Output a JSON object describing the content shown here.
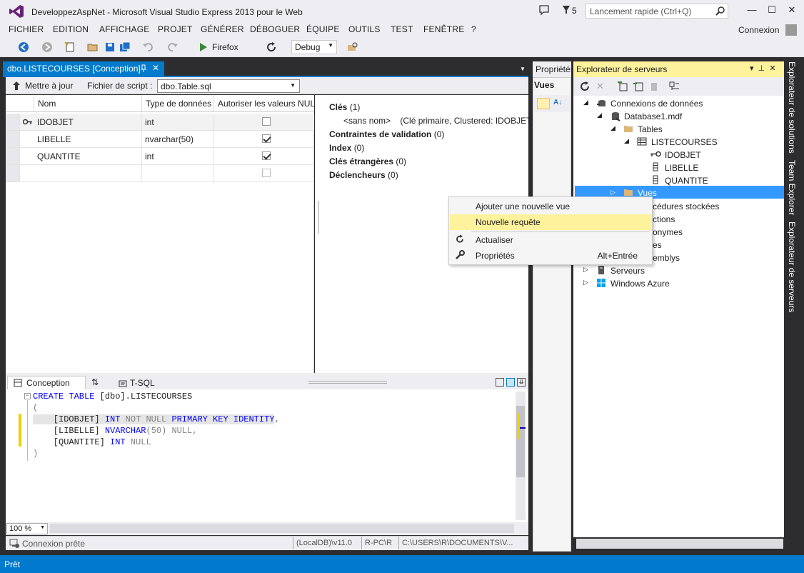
{
  "window": {
    "title": "DeveloppezAspNet - Microsoft Visual Studio Express 2013 pour le Web",
    "notification_count": "5",
    "quick_launch_placeholder": "Lancement rapide (Ctrl+Q)",
    "connexion": "Connexion"
  },
  "menu": [
    "FICHIER",
    "EDITION",
    "AFFICHAGE",
    "PROJET",
    "GÉNÉRER",
    "DÉBOGUER",
    "ÉQUIPE",
    "OUTILS",
    "TEST",
    "FENÊTRE",
    "?"
  ],
  "toolbar": {
    "browser": "Firefox",
    "configuration": "Debug"
  },
  "document": {
    "tab_title": "dbo.LISTECOURSES [Conception]",
    "update_label": "Mettre à jour",
    "script_label": "Fichier de script :",
    "script_file": "dbo.Table.sql"
  },
  "grid": {
    "headers": [
      "Nom",
      "Type de données",
      "Autoriser les valeurs NULL"
    ],
    "rows": [
      {
        "name": "IDOBJET",
        "type": "int",
        "nullable": false,
        "key": true
      },
      {
        "name": "LIBELLE",
        "type": "nvarchar(50)",
        "nullable": true,
        "key": false
      },
      {
        "name": "QUANTITE",
        "type": "int",
        "nullable": true,
        "key": false
      },
      {
        "name": "",
        "type": "",
        "nullable": false,
        "key": false
      }
    ]
  },
  "properties": {
    "keys_label": "Clés",
    "keys_count": "(1)",
    "key_item": "<sans nom>",
    "key_desc": "(Clé primaire, Clustered: IDOBJET)",
    "constraints_label": "Contraintes de validation",
    "constraints_count": "(0)",
    "index_label": "Index",
    "index_count": "(0)",
    "foreign_label": "Clés étrangères",
    "foreign_count": "(0)",
    "triggers_label": "Déclencheurs",
    "triggers_count": "(0)"
  },
  "bottom_tabs": {
    "conception": "Conception",
    "swap": "⇅",
    "tsql": "T-SQL"
  },
  "sql": {
    "l1_kw": "CREATE TABLE",
    "l1_rest": " [dbo].LISTECOURSES",
    "l2": "(",
    "l3_col": "    [IDOBJET]",
    "l3_type": " INT",
    "l3_null": " NOT NULL",
    "l3_pk": " PRIMARY KEY IDENTITY",
    "l3_end": ",",
    "l4_col": "    [LIBELLE]",
    "l4_type": " NVARCHAR",
    "l4_len": "(50)",
    "l4_null": " NULL",
    "l4_end": ",",
    "l5_col": "    [QUANTITE]",
    "l5_type": " INT",
    "l5_null": " NULL",
    "l6": ")"
  },
  "editor_status": {
    "zoom": "100 %",
    "connection": "Connexion prête",
    "server": "(LocalDB)\\v11.0",
    "machine": "R-PC\\R",
    "path": "C:\\USERS\\R\\DOCUMENTS\\V..."
  },
  "properties_panel": {
    "title": "Propriétés",
    "vues": "Vues"
  },
  "server_explorer": {
    "title": "Explorateur de serveurs",
    "tree": {
      "connections": "Connexions de données",
      "database": "Database1.mdf",
      "tables": "Tables",
      "table": "LISTECOURSES",
      "col1": "IDOBJET",
      "col2": "LIBELLE",
      "col3": "QUANTITE",
      "views": "Vues",
      "procs_partial": "cédures stockées",
      "functions_partial": "ctions",
      "synonyms_partial": "onymes",
      "types_partial": "es",
      "assemblies_partial": "emblys",
      "servers": "Serveurs",
      "azure": "Windows Azure"
    }
  },
  "side_tabs": [
    "Explorateur de solutions",
    "Team Explorer",
    "Explorateur de serveurs"
  ],
  "context_menu": {
    "add_view": "Ajouter une nouvelle vue",
    "new_query": "Nouvelle requête",
    "refresh": "Actualiser",
    "properties": "Propriétés",
    "properties_shortcut": "Alt+Entrée"
  },
  "status": {
    "text": "Prêt"
  },
  "colors": {
    "accent": "#007acc",
    "highlight": "#fff29d",
    "selection": "#3399ff",
    "logo": "#68217a"
  }
}
